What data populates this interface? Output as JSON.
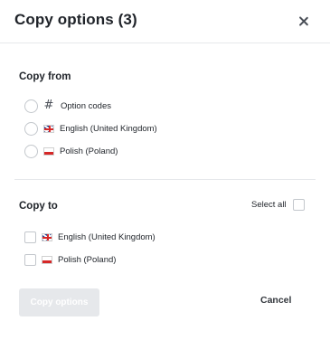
{
  "dialog": {
    "title": "Copy options (3)",
    "close_icon": "close-icon"
  },
  "copy_from": {
    "title": "Copy from",
    "options": [
      {
        "label": "Option codes",
        "icon": "hash-icon"
      },
      {
        "label": "English (United Kingdom)",
        "icon": "uk-flag-icon"
      },
      {
        "label": "Polish (Poland)",
        "icon": "poland-flag-icon"
      }
    ]
  },
  "copy_to": {
    "title": "Copy to",
    "select_all_label": "Select all",
    "options": [
      {
        "label": "English (United Kingdom)",
        "icon": "uk-flag-icon"
      },
      {
        "label": "Polish (Poland)",
        "icon": "poland-flag-icon"
      }
    ]
  },
  "footer": {
    "copy_button_label": "Copy options",
    "cancel_button_label": "Cancel"
  },
  "colors": {
    "disabled_button": "#e6e8eb",
    "flag_red": "#d62828",
    "flag_blue": "#1f3d8f"
  }
}
